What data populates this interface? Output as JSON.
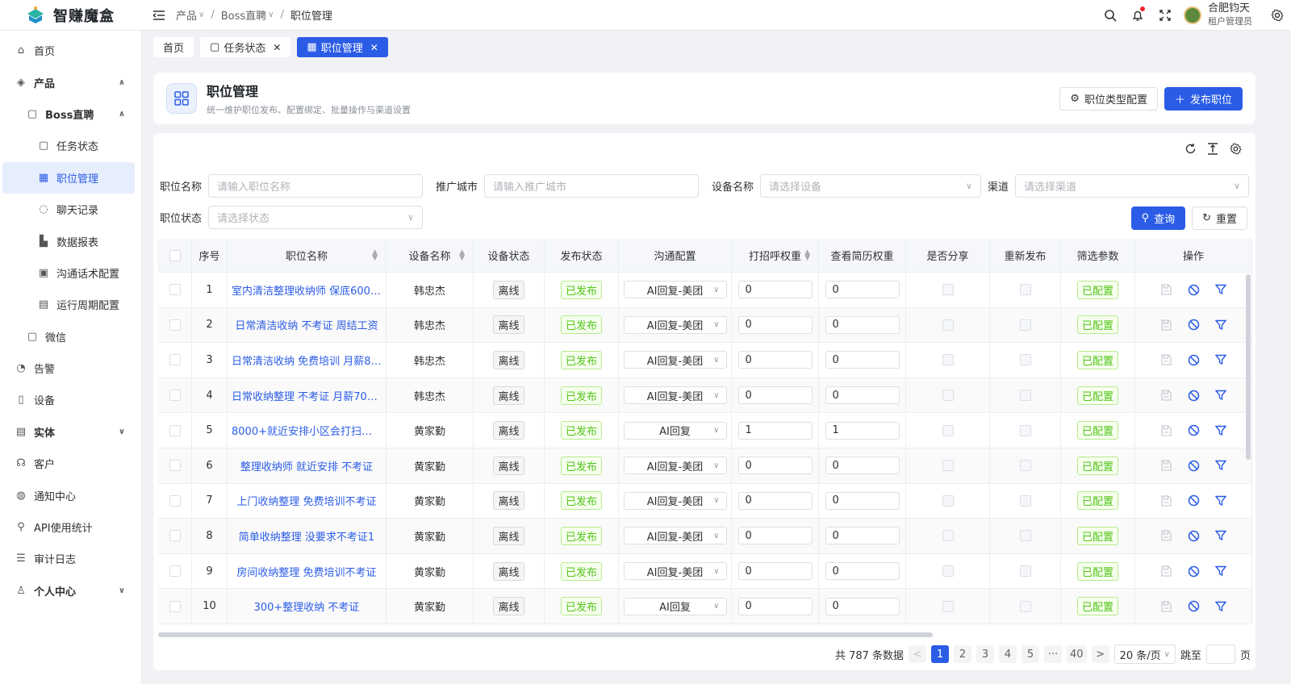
{
  "app": {
    "name": "智赚魔盒",
    "brand_color": "#2b5ce6"
  },
  "breadcrumb": [
    {
      "label": "产品"
    },
    {
      "label": "Boss直聘"
    },
    {
      "label": "职位管理"
    }
  ],
  "user": {
    "name": "合肥钧天",
    "role": "租户管理员"
  },
  "sidebar": {
    "items": [
      {
        "label": "首页",
        "icon": "home-icon"
      },
      {
        "label": "产品",
        "icon": "cube-icon"
      },
      {
        "label": "Boss直聘",
        "icon": "clipboard-icon"
      },
      {
        "label": "任务状态",
        "icon": "clipboard-icon"
      },
      {
        "label": "职位管理",
        "icon": "grid-icon"
      },
      {
        "label": "聊天记录",
        "icon": "chat-icon"
      },
      {
        "label": "数据报表",
        "icon": "bar-chart-icon"
      },
      {
        "label": "沟通话术配置",
        "icon": "script-icon"
      },
      {
        "label": "运行周期配置",
        "icon": "calendar-icon"
      },
      {
        "label": "微信",
        "icon": "clipboard-icon"
      },
      {
        "label": "告警",
        "icon": "alarm-icon"
      },
      {
        "label": "设备",
        "icon": "phone-icon"
      },
      {
        "label": "实体",
        "icon": "list-icon"
      },
      {
        "label": "客户",
        "icon": "customer-icon"
      },
      {
        "label": "通知中心",
        "icon": "message-icon"
      },
      {
        "label": "API使用统计",
        "icon": "link-icon"
      },
      {
        "label": "审计日志",
        "icon": "log-icon"
      },
      {
        "label": "个人中心",
        "icon": "user-icon"
      }
    ]
  },
  "tabs": [
    {
      "label": "首页"
    },
    {
      "label": "任务状态"
    },
    {
      "label": "职位管理"
    }
  ],
  "page": {
    "title": "职位管理",
    "subtitle": "统一维护职位发布、配置绑定、批量操作与渠道设置",
    "config_button": "职位类型配置",
    "publish_button": "发布职位"
  },
  "filters": {
    "job_name": {
      "label": "职位名称",
      "placeholder": "请输入职位名称"
    },
    "city": {
      "label": "推广城市",
      "placeholder": "请输入推广城市"
    },
    "device": {
      "label": "设备名称",
      "placeholder": "请选择设备"
    },
    "channel": {
      "label": "渠道",
      "placeholder": "请选择渠道"
    },
    "status": {
      "label": "职位状态",
      "placeholder": "请选择状态"
    },
    "query_button": "查询",
    "reset_button": "重置"
  },
  "table": {
    "columns": [
      "序号",
      "职位名称",
      "设备名称",
      "设备状态",
      "发布状态",
      "沟通配置",
      "打招呼权重",
      "查看简历权重",
      "是否分享",
      "重新发布",
      "筛选参数",
      "操作"
    ],
    "rows": [
      {
        "no": "1",
        "job": "室内清洁整理收纳师 保底6000 ...",
        "device": "韩忠杰",
        "dev_status": "离线",
        "pub_status": "已发布",
        "comm": "AI回复-美团",
        "greet": "0",
        "resume": "0",
        "filter": "已配置"
      },
      {
        "no": "2",
        "job": "日常清洁收纳 不考证 周结工资",
        "device": "韩忠杰",
        "dev_status": "离线",
        "pub_status": "已发布",
        "comm": "AI回复-美团",
        "greet": "0",
        "resume": "0",
        "filter": "已配置"
      },
      {
        "no": "3",
        "job": "日常清洁收纳 免费培训 月薪80...",
        "device": "韩忠杰",
        "dev_status": "离线",
        "pub_status": "已发布",
        "comm": "AI回复-美团",
        "greet": "0",
        "resume": "0",
        "filter": "已配置"
      },
      {
        "no": "4",
        "job": "日常收纳整理 不考证 月薪7000...",
        "device": "韩忠杰",
        "dev_status": "离线",
        "pub_status": "已发布",
        "comm": "AI回复-美团",
        "greet": "0",
        "resume": "0",
        "filter": "已配置"
      },
      {
        "no": "5",
        "job": "8000+就近安排小区会打扫就行",
        "device": "黄家勤",
        "dev_status": "离线",
        "pub_status": "已发布",
        "comm": "AI回复",
        "greet": "1",
        "resume": "1",
        "filter": "已配置"
      },
      {
        "no": "6",
        "job": "整理收纳师 就近安排 不考证",
        "device": "黄家勤",
        "dev_status": "离线",
        "pub_status": "已发布",
        "comm": "AI回复-美团",
        "greet": "0",
        "resume": "0",
        "filter": "已配置"
      },
      {
        "no": "7",
        "job": "上门收纳整理 免费培训不考证",
        "device": "黄家勤",
        "dev_status": "离线",
        "pub_status": "已发布",
        "comm": "AI回复-美团",
        "greet": "0",
        "resume": "0",
        "filter": "已配置"
      },
      {
        "no": "8",
        "job": "简单收纳整理 没要求不考证1",
        "device": "黄家勤",
        "dev_status": "离线",
        "pub_status": "已发布",
        "comm": "AI回复-美团",
        "greet": "0",
        "resume": "0",
        "filter": "已配置"
      },
      {
        "no": "9",
        "job": "房间收纳整理 免费培训不考证",
        "device": "黄家勤",
        "dev_status": "离线",
        "pub_status": "已发布",
        "comm": "AI回复-美团",
        "greet": "0",
        "resume": "0",
        "filter": "已配置"
      },
      {
        "no": "10",
        "job": "300+整理收纳 不考证",
        "device": "黄家勤",
        "dev_status": "离线",
        "pub_status": "已发布",
        "comm": "AI回复",
        "greet": "0",
        "resume": "0",
        "filter": "已配置"
      }
    ]
  },
  "pagination": {
    "total": "共 787 条数据",
    "pages": [
      "1",
      "2",
      "3",
      "4",
      "5",
      "···",
      "40"
    ],
    "current": "1",
    "page_size": "20 条/页",
    "jump_label": "跳至",
    "page_suffix": "页"
  }
}
